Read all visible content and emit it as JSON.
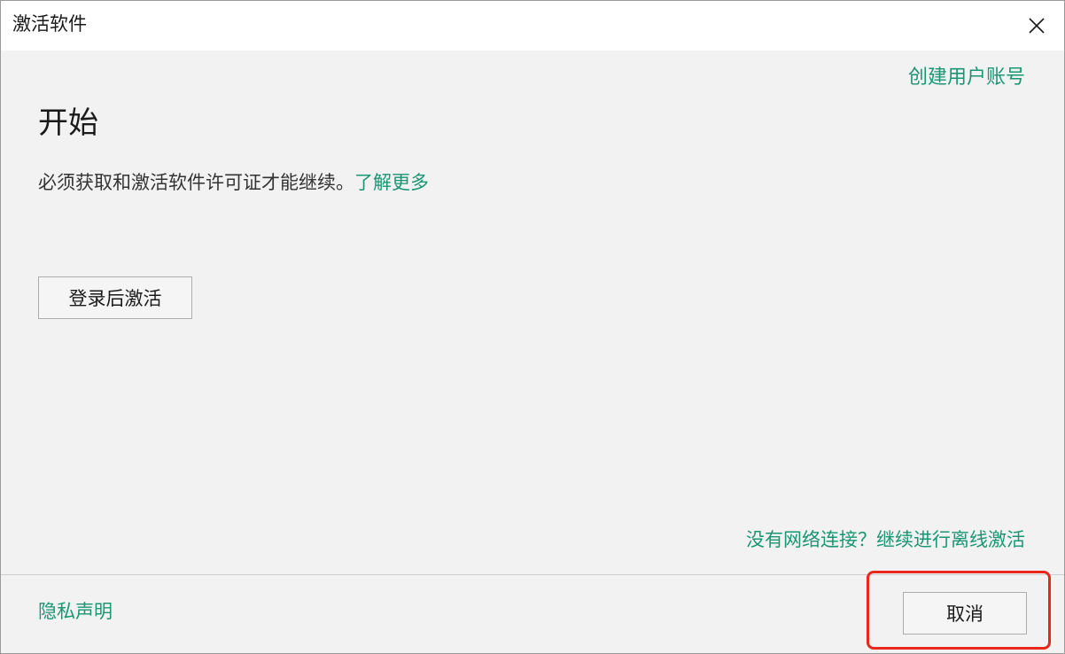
{
  "window": {
    "title": "激活软件",
    "close_icon": "close-icon"
  },
  "header": {
    "create_account_label": "创建用户账号"
  },
  "main": {
    "heading": "开始",
    "description": "必须获取和激活软件许可证才能继续。",
    "learn_more_label": "了解更多",
    "login_activate_label": "登录后激活",
    "offline_link_label": "没有网络连接？继续进行离线激活"
  },
  "footer": {
    "privacy_label": "隐私声明",
    "cancel_label": "取消"
  },
  "colors": {
    "link": "#1a9673",
    "highlight": "#e8281c",
    "background": "#f2f2f2"
  }
}
